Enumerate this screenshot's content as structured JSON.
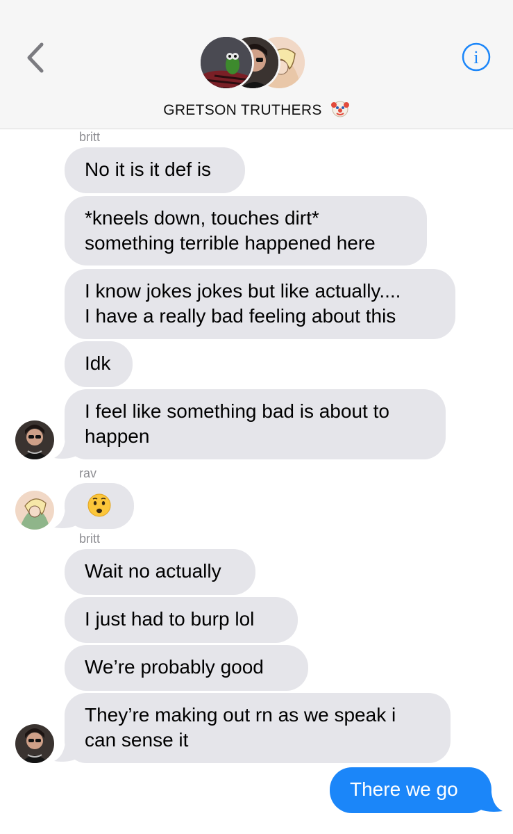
{
  "header": {
    "group_name": "GRETSON TRUTHERS",
    "group_emoji": "clown-face-emoji",
    "back_icon": "chevron-left-icon",
    "info_icon": "info-icon"
  },
  "colors": {
    "header_bg": "#f6f6f6",
    "received_bubble": "#e5e5ea",
    "sent_bubble": "#1b86f9",
    "accent": "#1b86f9",
    "sender_label": "#8e8e93"
  },
  "messages": [
    {
      "sender": "britt"
    },
    {
      "text": "No it is it def is"
    },
    {
      "line1": "*kneels down, touches dirt*",
      "line2": "something terrible happened here"
    },
    {
      "line1": "I know jokes jokes but like actually....",
      "line2": "I have a really bad feeling about this"
    },
    {
      "text": "Idk"
    },
    {
      "line1": "I feel like something bad is about to",
      "line2": "happen"
    },
    {
      "sender": "rav"
    },
    {
      "emoji": "anxious-face-emoji"
    },
    {
      "sender": "britt"
    },
    {
      "text": "Wait no actually"
    },
    {
      "text": "I just had to burp lol"
    },
    {
      "text": "We’re probably good"
    },
    {
      "line1": "They’re making out rn as we speak i",
      "line2": "can sense it"
    },
    {
      "text": "There we go"
    }
  ]
}
